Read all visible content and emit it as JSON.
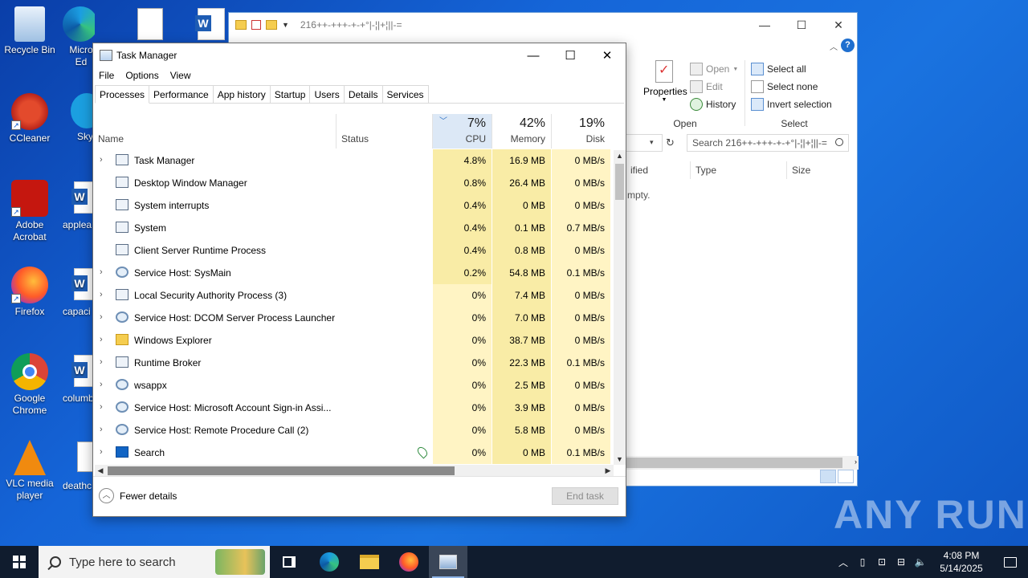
{
  "desktop": {
    "icons": [
      {
        "label": "Recycle Bin"
      },
      {
        "label": "CCleaner"
      },
      {
        "label": "Adobe Acrobat"
      },
      {
        "label": "Firefox"
      },
      {
        "label": "Google Chrome"
      },
      {
        "label": "VLC media player"
      }
    ],
    "partial_icons": [
      {
        "label": "Micro Ed"
      },
      {
        "label": "Sky"
      },
      {
        "label": "applea"
      },
      {
        "label": "capaci"
      },
      {
        "label": "columb"
      },
      {
        "label": "deathc"
      }
    ]
  },
  "explorer": {
    "title": "216++-+++-+-+°|-¦|+¦||-=",
    "ribbon": {
      "properties_label": "Properties",
      "open_label": "Open",
      "edit_label": "Edit",
      "history_label": "History",
      "group_open": "Open",
      "select_all": "Select all",
      "select_none": "Select none",
      "invert_selection": "Invert selection",
      "group_select": "Select"
    },
    "search_placeholder": "Search 216++-+++-+-+°|-¦|+¦||-=",
    "columns": {
      "modified": "ified",
      "type": "Type",
      "size": "Size"
    },
    "empty_text": "mpty."
  },
  "taskmgr": {
    "title": "Task Manager",
    "menu": [
      "File",
      "Options",
      "View"
    ],
    "tabs": [
      "Processes",
      "Performance",
      "App history",
      "Startup",
      "Users",
      "Details",
      "Services"
    ],
    "active_tab": "Processes",
    "columns": {
      "name": "Name",
      "status": "Status",
      "cpu": {
        "pct": "7%",
        "label": "CPU"
      },
      "memory": {
        "pct": "42%",
        "label": "Memory"
      },
      "disk": {
        "pct": "19%",
        "label": "Disk"
      }
    },
    "processes": [
      {
        "name": "Task Manager",
        "expandable": true,
        "icon": "taskmgr-icon",
        "cpu": "4.8%",
        "memory": "16.9 MB",
        "disk": "0 MB/s"
      },
      {
        "name": "Desktop Window Manager",
        "expandable": false,
        "icon": "window-icon",
        "cpu": "0.8%",
        "memory": "26.4 MB",
        "disk": "0 MB/s"
      },
      {
        "name": "System interrupts",
        "expandable": false,
        "icon": "window-icon",
        "cpu": "0.4%",
        "memory": "0 MB",
        "disk": "0 MB/s"
      },
      {
        "name": "System",
        "expandable": false,
        "icon": "window-icon",
        "cpu": "0.4%",
        "memory": "0.1 MB",
        "disk": "0.7 MB/s"
      },
      {
        "name": "Client Server Runtime Process",
        "expandable": false,
        "icon": "window-icon",
        "cpu": "0.4%",
        "memory": "0.8 MB",
        "disk": "0 MB/s"
      },
      {
        "name": "Service Host: SysMain",
        "expandable": true,
        "icon": "gear-icon",
        "cpu": "0.2%",
        "memory": "54.8 MB",
        "disk": "0.1 MB/s"
      },
      {
        "name": "Local Security Authority Process (3)",
        "expandable": true,
        "icon": "window-icon",
        "cpu": "0%",
        "memory": "7.4 MB",
        "disk": "0 MB/s"
      },
      {
        "name": "Service Host: DCOM Server Process Launcher...",
        "expandable": true,
        "icon": "gear-icon",
        "cpu": "0%",
        "memory": "7.0 MB",
        "disk": "0 MB/s"
      },
      {
        "name": "Windows Explorer",
        "expandable": true,
        "icon": "folder-icon",
        "cpu": "0%",
        "memory": "38.7 MB",
        "disk": "0 MB/s"
      },
      {
        "name": "Runtime Broker",
        "expandable": true,
        "icon": "window-icon",
        "cpu": "0%",
        "memory": "22.3 MB",
        "disk": "0.1 MB/s"
      },
      {
        "name": "wsappx",
        "expandable": true,
        "icon": "gear-icon",
        "cpu": "0%",
        "memory": "2.5 MB",
        "disk": "0 MB/s"
      },
      {
        "name": "Service Host: Microsoft Account Sign-in Assi...",
        "expandable": true,
        "icon": "gear-icon",
        "cpu": "0%",
        "memory": "3.9 MB",
        "disk": "0 MB/s"
      },
      {
        "name": "Service Host: Remote Procedure Call (2)",
        "expandable": true,
        "icon": "gear-icon",
        "cpu": "0%",
        "memory": "5.8 MB",
        "disk": "0 MB/s"
      },
      {
        "name": "Search",
        "expandable": true,
        "icon": "search-icon",
        "status_icon": "leaf-icon",
        "cpu": "0%",
        "memory": "0 MB",
        "disk": "0.1 MB/s"
      }
    ],
    "footer": {
      "fewer_details": "Fewer details",
      "end_task": "End task"
    }
  },
  "taskbar": {
    "search_placeholder": "Type here to search",
    "time": "4:08 PM",
    "date": "5/14/2025"
  },
  "watermark": "ANY RUN",
  "colors": {
    "heat_strong": "#f9eca6",
    "heat_light": "#fff4c4",
    "accent": "#1f6fcf",
    "taskbar": "#101c2e"
  }
}
